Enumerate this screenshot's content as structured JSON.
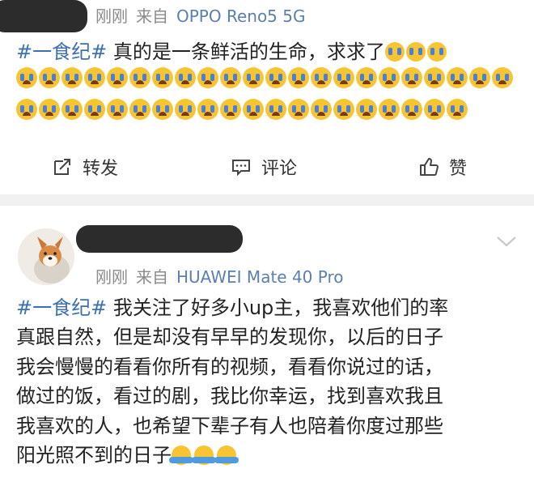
{
  "post1": {
    "time": "刚刚",
    "from_label": "来自",
    "device": "OPPO Reno5 5G",
    "hashtag": "#一食纪#",
    "text": " 真的是一条鲜活的生命，求求了",
    "emoji_inline_count": 3,
    "emoji_row1_count": 22,
    "emoji_row2_count": 20,
    "emoji_name": "crying-face"
  },
  "actions": {
    "repost": "转发",
    "comment": "评论",
    "like": "赞"
  },
  "post2": {
    "time": "刚刚",
    "from_label": "来自",
    "device": "HUAWEI Mate 40 Pro",
    "hashtag": "#一食纪#",
    "lines": [
      " 我关注了好多小up主，我喜欢他们的率",
      "真跟自然，但是却没有早早的发现你，以后的日子",
      "我会慢慢的看看你所有的视频，看看你说过的话，",
      "做过的饭，看过的剧，我比你幸运，找到喜欢我且",
      "我喜欢的人，也希望下辈子有人也陪着你度过那些",
      "阳光照不到的日子"
    ],
    "hug_emoji_count": 3,
    "emoji_name": "hug-face"
  },
  "colors": {
    "hashtag": "#3d6fb3",
    "device": "#5b7fb0",
    "meta": "#8a8a8a",
    "divider": "#f1f1f1"
  }
}
